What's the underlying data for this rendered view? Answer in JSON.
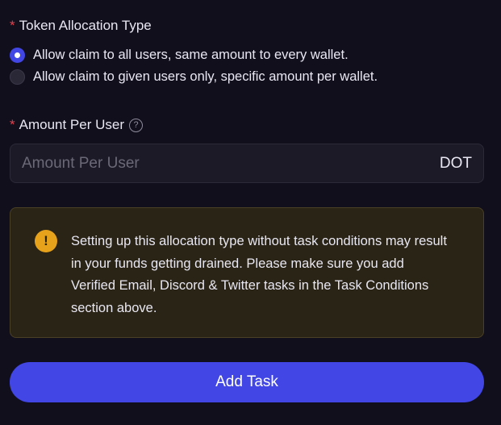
{
  "allocation": {
    "label": "Token Allocation Type",
    "required_mark": "*",
    "options": [
      {
        "label": "Allow claim to all users, same amount to every wallet.",
        "checked": true
      },
      {
        "label": "Allow claim to given users only, specific amount per wallet.",
        "checked": false
      }
    ]
  },
  "amount": {
    "label": "Amount Per User",
    "required_mark": "*",
    "help_icon": "?",
    "placeholder": "Amount Per User",
    "value": "",
    "unit": "DOT"
  },
  "warning": {
    "icon": "!",
    "text": "Setting up this allocation type without task conditions may result in your funds getting drained. Please make sure you add Verified Email, Discord & Twitter tasks in the Task Conditions section above."
  },
  "actions": {
    "add_task_label": "Add Task"
  },
  "colors": {
    "accent": "#4146e4",
    "required": "#e0434f",
    "warning": "#e6a21b",
    "background": "#120f1d"
  }
}
